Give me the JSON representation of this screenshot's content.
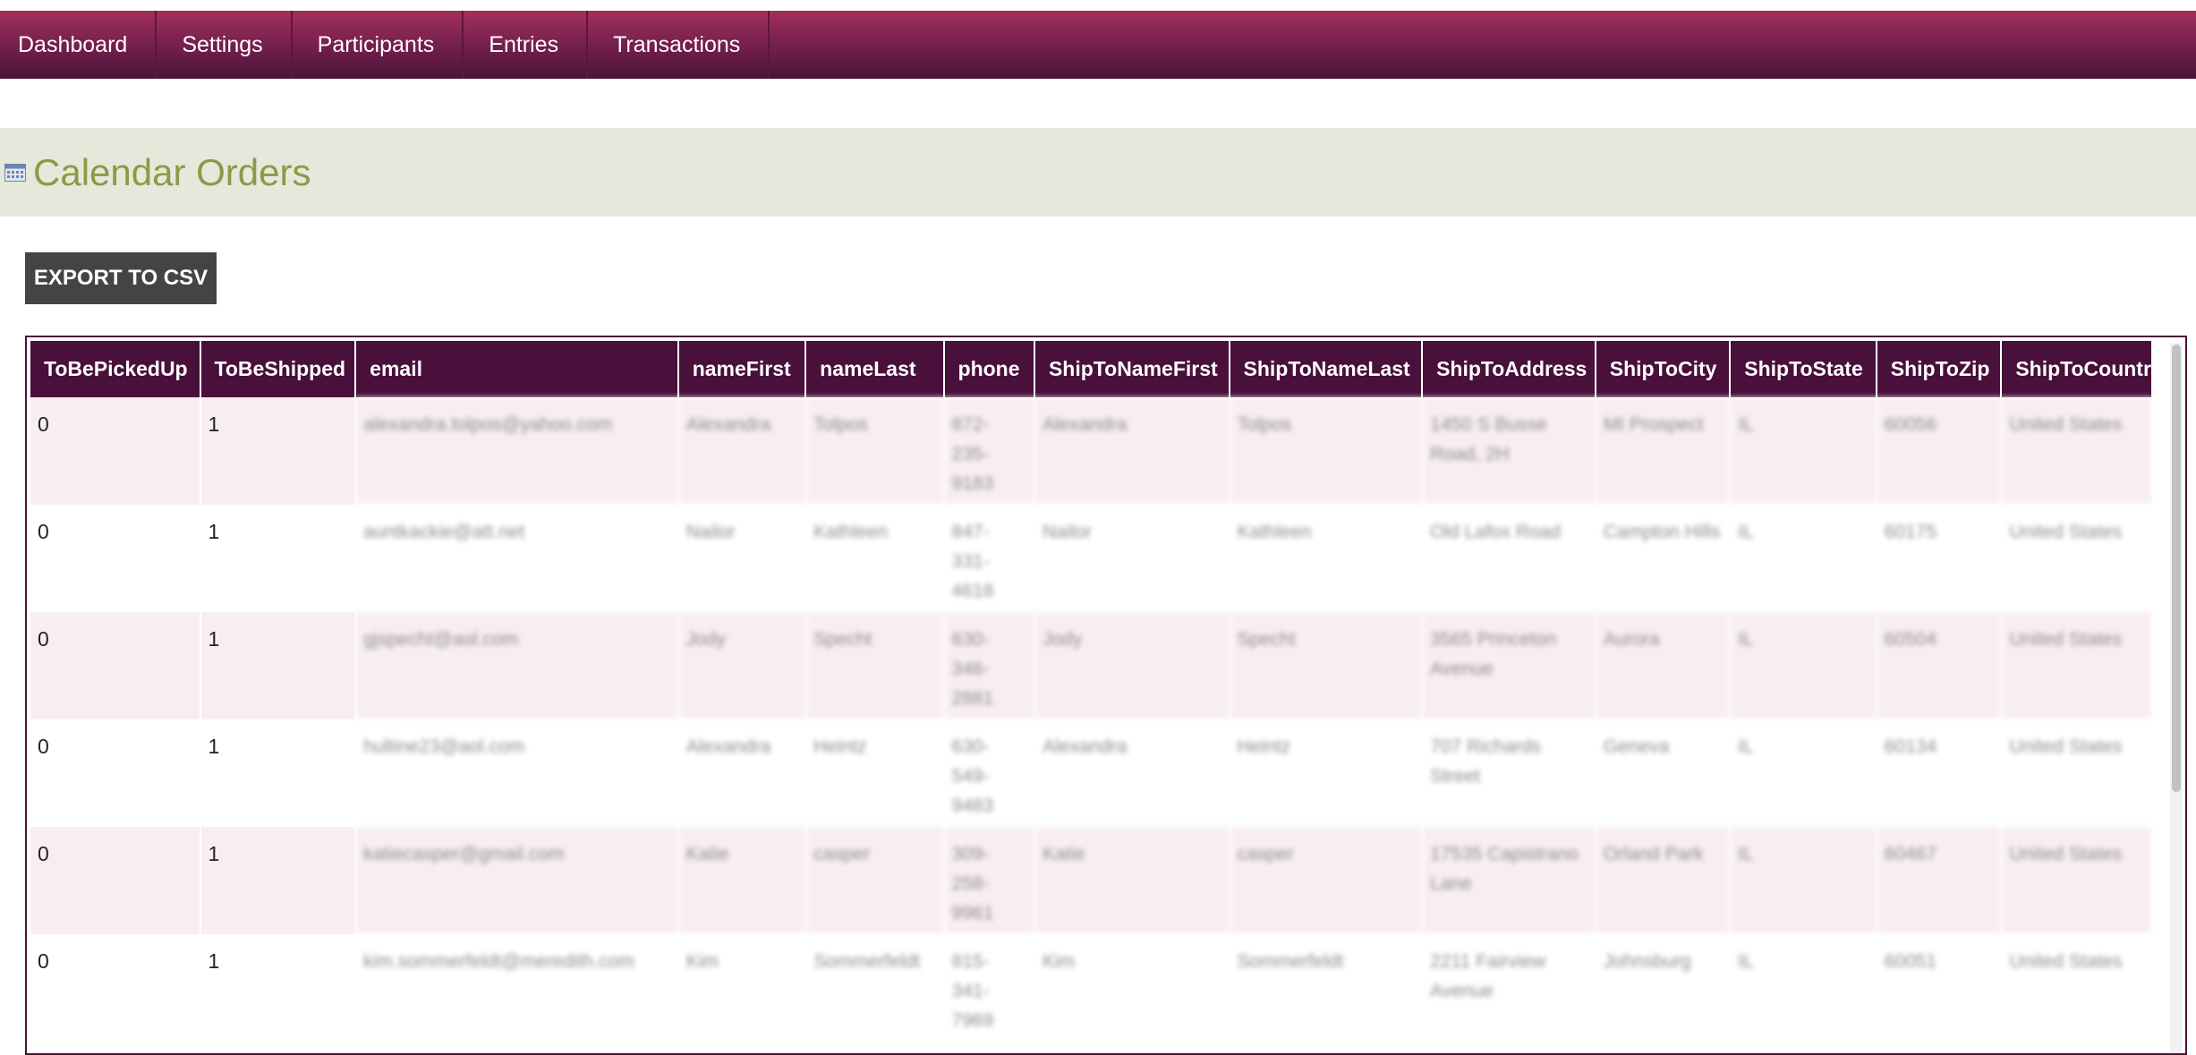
{
  "nav": {
    "items": [
      {
        "label": "Dashboard"
      },
      {
        "label": "Settings"
      },
      {
        "label": "Participants"
      },
      {
        "label": "Entries"
      },
      {
        "label": "Transactions"
      }
    ]
  },
  "page": {
    "title": "Calendar Orders",
    "export_label": "EXPORT TO CSV"
  },
  "table": {
    "headers": [
      "ToBePickedUp",
      "ToBeShipped",
      "email",
      "nameFirst",
      "nameLast",
      "phone",
      "ShipToNameFirst",
      "ShipToNameLast",
      "ShipToAddress",
      "ShipToCity",
      "ShipToState",
      "ShipToZip",
      "ShipToCountr"
    ],
    "rows": [
      [
        "0",
        "1",
        "alexandra.tolpos@yahoo.com",
        "Alexandra",
        "Tolpos",
        "872-235-9183",
        "Alexandra",
        "Tolpos",
        "1450 S Busse Road, 2H",
        "Mt Prospect",
        "IL",
        "60056",
        "United States"
      ],
      [
        "0",
        "1",
        "auntkackie@att.net",
        "Nailor",
        "Kathleen",
        "847-331-4618",
        "Nailor",
        "Kathleen",
        "Old Lafox Road",
        "Campton Hills",
        "IL",
        "60175",
        "United States"
      ],
      [
        "0",
        "1",
        "gjspecht@aol.com",
        "Jody",
        "Specht",
        "630-346-2881",
        "Jody",
        "Specht",
        "3565 Princeton Avenue",
        "Aurora",
        "IL",
        "60504",
        "United States"
      ],
      [
        "0",
        "1",
        "hultine23@aol.com",
        "Alexandra",
        "Heintz",
        "630-549-9483",
        "Alexandra",
        "Heintz",
        "707 Richards Street",
        "Geneva",
        "IL",
        "60134",
        "United States"
      ],
      [
        "0",
        "1",
        "katiecasper@gmail.com",
        "Katie",
        "casper",
        "309-258-9961",
        "Katie",
        "casper",
        "17535 Capistrano Lane",
        "Orland Park",
        "IL",
        "60467",
        "United States"
      ],
      [
        "0",
        "1",
        "kim.sommerfeldt@meredith.com",
        "Kim",
        "Sommerfeldt",
        "815-341-7969",
        "Kim",
        "Sommerfeldt",
        "2211 Fairview Avenue",
        "Johnsburg",
        "IL",
        "60051",
        "United States"
      ]
    ]
  },
  "colors": {
    "nav_top": "#a3305b",
    "nav_bottom": "#4a1438",
    "header_bg": "#48103a",
    "title_green": "#8b9a44",
    "band_bg": "#e6e8dc",
    "row_alt": "#f8eef2"
  },
  "icons": {
    "title_icon": "calendar-icon"
  }
}
